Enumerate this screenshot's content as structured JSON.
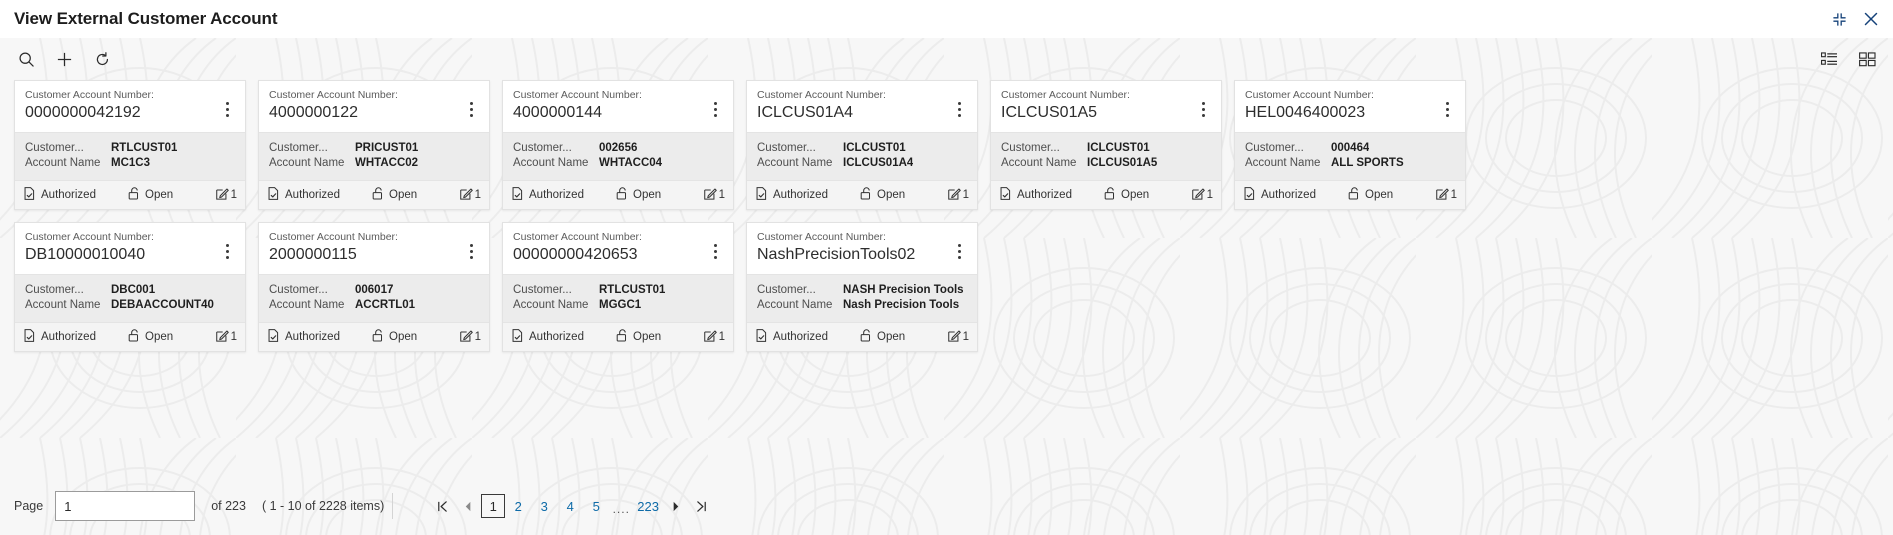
{
  "header": {
    "title": "View External Customer Account",
    "minimize_icon": "collapse-icon",
    "close_icon": "close-icon"
  },
  "toolbar": {
    "search_icon": "search-icon",
    "add_icon": "plus-icon",
    "refresh_icon": "refresh-icon",
    "list_view_icon": "list-view-icon",
    "grid_view_icon": "grid-view-icon"
  },
  "card_labels": {
    "account_number_label": "Customer Account Number:",
    "customer_key": "Customer...",
    "account_name_key": "Account Name",
    "status_icon": "document-check-icon",
    "lock_icon": "unlock-icon",
    "edit_icon": "edit-icon"
  },
  "cards": [
    {
      "account_number": "0000000042192",
      "customer": "RTLCUST01",
      "account_name": "MC1C3",
      "status": "Authorized",
      "lock_state": "Open",
      "version": "1"
    },
    {
      "account_number": "4000000122",
      "customer": "PRICUST01",
      "account_name": "WHTACC02",
      "status": "Authorized",
      "lock_state": "Open",
      "version": "1"
    },
    {
      "account_number": "4000000144",
      "customer": "002656",
      "account_name": "WHTACC04",
      "status": "Authorized",
      "lock_state": "Open",
      "version": "1"
    },
    {
      "account_number": "ICLCUS01A4",
      "customer": "ICLCUST01",
      "account_name": "ICLCUS01A4",
      "status": "Authorized",
      "lock_state": "Open",
      "version": "1"
    },
    {
      "account_number": "ICLCUS01A5",
      "customer": "ICLCUST01",
      "account_name": "ICLCUS01A5",
      "status": "Authorized",
      "lock_state": "Open",
      "version": "1"
    },
    {
      "account_number": "HEL0046400023",
      "customer": "000464",
      "account_name": "ALL SPORTS",
      "status": "Authorized",
      "lock_state": "Open",
      "version": "1"
    },
    {
      "account_number": "DB10000010040",
      "customer": "DBC001",
      "account_name": "DEBAACCOUNT40",
      "status": "Authorized",
      "lock_state": "Open",
      "version": "1"
    },
    {
      "account_number": "2000000115",
      "customer": "006017",
      "account_name": "ACCRTL01",
      "status": "Authorized",
      "lock_state": "Open",
      "version": "1"
    },
    {
      "account_number": "00000000420653",
      "customer": "RTLCUST01",
      "account_name": "MGGC1",
      "status": "Authorized",
      "lock_state": "Open",
      "version": "1"
    },
    {
      "account_number": "NashPrecisionTools02",
      "customer": "NASH Precision Tools",
      "account_name": "Nash Precision Tools",
      "status": "Authorized",
      "lock_state": "Open",
      "version": "1"
    }
  ],
  "pagination": {
    "page_label": "Page",
    "page_value": "1",
    "of_text": "of 223",
    "items_text": "( 1 - 10 of 2228 items)",
    "first_icon": "first-page-icon",
    "prev_icon": "prev-page-icon",
    "next_icon": "next-page-icon",
    "last_icon": "last-page-icon",
    "pages": [
      "1",
      "2",
      "3",
      "4",
      "5"
    ],
    "ellipsis": "....",
    "last_page": "223",
    "current_page": "1"
  },
  "colors": {
    "link": "#0e6ba8",
    "card_body_bg": "#ececec",
    "workspace_bg": "#f7f7f7"
  }
}
